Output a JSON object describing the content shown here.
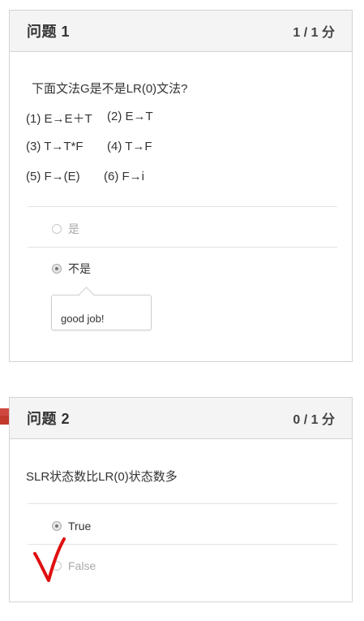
{
  "question1": {
    "title": "问题 1",
    "score": "1 / 1 分",
    "prompt": "下面文法G是不是LR(0)文法?",
    "grammar": [
      [
        "(1) E→E＋T",
        "(2) E→T"
      ],
      [
        "(3) T→T*F",
        "(4) T→F"
      ],
      [
        "(5) F→(E)",
        "(6) F→i"
      ]
    ],
    "options": [
      {
        "label": "是",
        "selected": false
      },
      {
        "label": "不是",
        "selected": true
      }
    ],
    "feedback": "good job!"
  },
  "question2": {
    "title": "问题 2",
    "score": "0 / 1 分",
    "prompt": "SLR状态数比LR(0)状态数多",
    "options": [
      {
        "label": "True",
        "selected": true
      },
      {
        "label": "False",
        "selected": false
      }
    ]
  },
  "colors": {
    "header_bg": "#f4f4f4",
    "border": "#d4d4d4",
    "flag": "#c0392b",
    "checkmark": "#e01010"
  }
}
